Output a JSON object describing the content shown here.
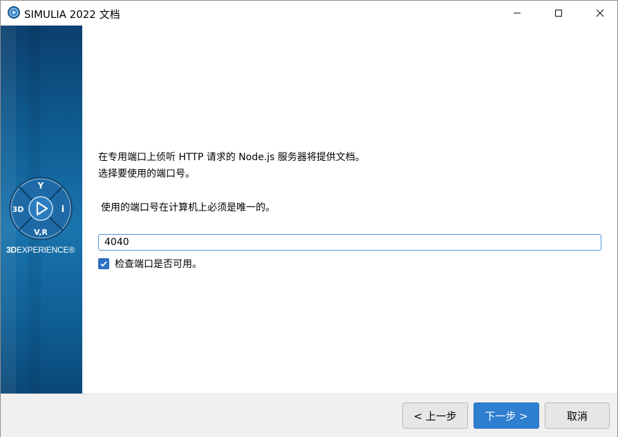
{
  "window": {
    "title": "SIMULIA 2022 文档"
  },
  "sidebar": {
    "logo_icon": "3dexperience-compass-icon",
    "compass_labels": {
      "top": "Y",
      "left": "3D",
      "right": "i",
      "bottom": "V,R"
    },
    "brand_bold": "3D",
    "brand_rest": "EXPERIENCE",
    "brand_mark": "®"
  },
  "main": {
    "description_line1": "在专用端口上侦听 HTTP 请求的 Node.js 服务器将提供文档。",
    "description_line2": "选择要使用的端口号。",
    "note": "使用的端口号在计算机上必须是唯一的。",
    "port_value": "4040",
    "check_port": {
      "label": "检查端口是否可用。",
      "checked": true
    }
  },
  "footer": {
    "back_label": "< 上一步",
    "next_label": "下一步 >",
    "cancel_label": "取消"
  },
  "colors": {
    "accent": "#2f7fd1",
    "sidebar_blue": "#0f5e93",
    "input_border": "#4a90d9",
    "checkbox": "#2c6fbf"
  }
}
